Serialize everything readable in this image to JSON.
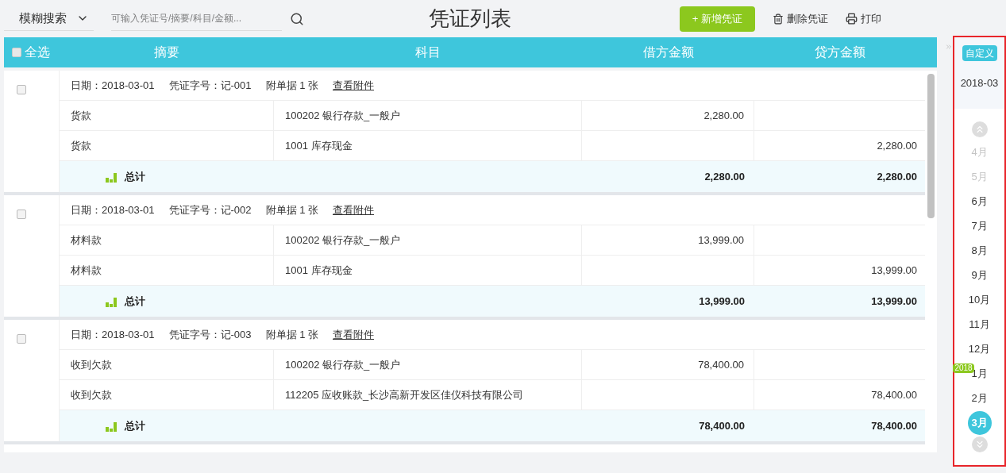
{
  "toolbar": {
    "search_mode": "模糊搜索",
    "search": {
      "placeholder": "可输入凭证号/摘要/科目/金额..."
    },
    "title": "凭证列表",
    "buttons": [
      {
        "kind": "primary",
        "label": "+ 新增凭证"
      },
      {
        "kind": "delete",
        "label": "删除凭证"
      },
      {
        "kind": "print",
        "label": "打印"
      }
    ]
  },
  "table": {
    "select_all": {
      "label": "全选",
      "checked": false
    },
    "columns": [
      "摘要",
      "科目",
      "借方金额",
      "贷方金额"
    ],
    "vouchers": [
      {
        "checked": false,
        "date": "日期：2018-03-01",
        "number": "凭证字号：记-001",
        "attachments": "附单据 1 张",
        "link": "查看附件",
        "lines": [
          {
            "summary": "货款",
            "account": "100202 银行存款_一般户",
            "debit": "2,280.00"
          },
          {
            "summary": "货款",
            "account": "1001 库存现金",
            "credit": "2,280.00"
          }
        ],
        "total": {
          "label": "总计",
          "debit": "2,280.00",
          "credit": "2,280.00"
        }
      },
      {
        "checked": false,
        "date": "日期：2018-03-01",
        "number": "凭证字号：记-002",
        "attachments": "附单据 1 张",
        "link": "查看附件",
        "lines": [
          {
            "summary": "材料款",
            "account": "100202 银行存款_一般户",
            "debit": "13,999.00"
          },
          {
            "summary": "材料款",
            "account": "1001 库存现金",
            "credit": "13,999.00"
          }
        ],
        "total": {
          "label": "总计",
          "debit": "13,999.00",
          "credit": "13,999.00"
        }
      },
      {
        "checked": false,
        "date": "日期：2018-03-01",
        "number": "凭证字号：记-003",
        "attachments": "附单据 1 张",
        "link": "查看附件",
        "lines": [
          {
            "summary": "收到欠款",
            "account": "100202 银行存款_一般户",
            "debit": "78,400.00"
          },
          {
            "summary": "收到欠款",
            "account": "112205 应收账款_长沙高新开发区佳仪科技有限公司",
            "credit": "78,400.00"
          }
        ],
        "total": {
          "label": "总计",
          "debit": "78,400.00",
          "credit": "78,400.00"
        }
      }
    ]
  },
  "period_panel": {
    "highlighted": true,
    "custom_button": "自定义",
    "current": "2018-03",
    "months": [
      {
        "label": "4月",
        "faded": true,
        "selected": false
      },
      {
        "label": "5月",
        "faded": true,
        "selected": false
      },
      {
        "label": "6月",
        "faded": false,
        "selected": false
      },
      {
        "label": "7月",
        "faded": false,
        "selected": false
      },
      {
        "label": "8月",
        "faded": false,
        "selected": false
      },
      {
        "label": "9月",
        "faded": false,
        "selected": false
      },
      {
        "label": "10月",
        "faded": false,
        "selected": false
      },
      {
        "label": "11月",
        "faded": false,
        "selected": false
      },
      {
        "label": "12月",
        "faded": false,
        "selected": false
      },
      {
        "label": "1月",
        "faded": false,
        "selected": false,
        "year_badge": "2018"
      },
      {
        "label": "2月",
        "faded": false,
        "selected": false
      },
      {
        "label": "3月",
        "faded": false,
        "selected": true
      }
    ]
  }
}
